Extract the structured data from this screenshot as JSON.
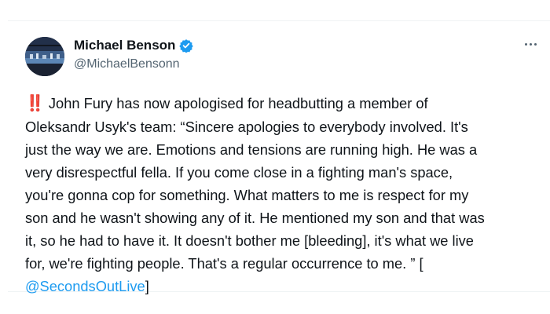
{
  "author": {
    "name": "Michael Benson",
    "handle": "@MichaelBensonn",
    "verified": true
  },
  "more_icon": "more-horizontal-icon",
  "tweet": {
    "emoji": "‼️",
    "lines": [
      "John Fury has now apologised for headbutting a member of",
      "Oleksandr Usyk's team: “Sincere apologies to everybody involved. It's",
      "just the way we are. Emotions and tensions are running high. He was a",
      "very disrespectful fella. If you come close in a fighting man's space,",
      "you're gonna cop for something. What matters to me is respect for my",
      "son and he wasn't showing any of it. He mentioned my son and that was",
      "it, so he had to have it. It doesn't bother me [bleeding], it's what we live",
      "for, we're fighting people. That's a regular occurrence to me. ” ["
    ],
    "mention": "@SecondsOutLive",
    "closing": "]"
  },
  "colors": {
    "text": "#0f1419",
    "secondary": "#536471",
    "link": "#1d9bf0",
    "verified": "#1d9bf0",
    "emoji": "#d7263d"
  }
}
